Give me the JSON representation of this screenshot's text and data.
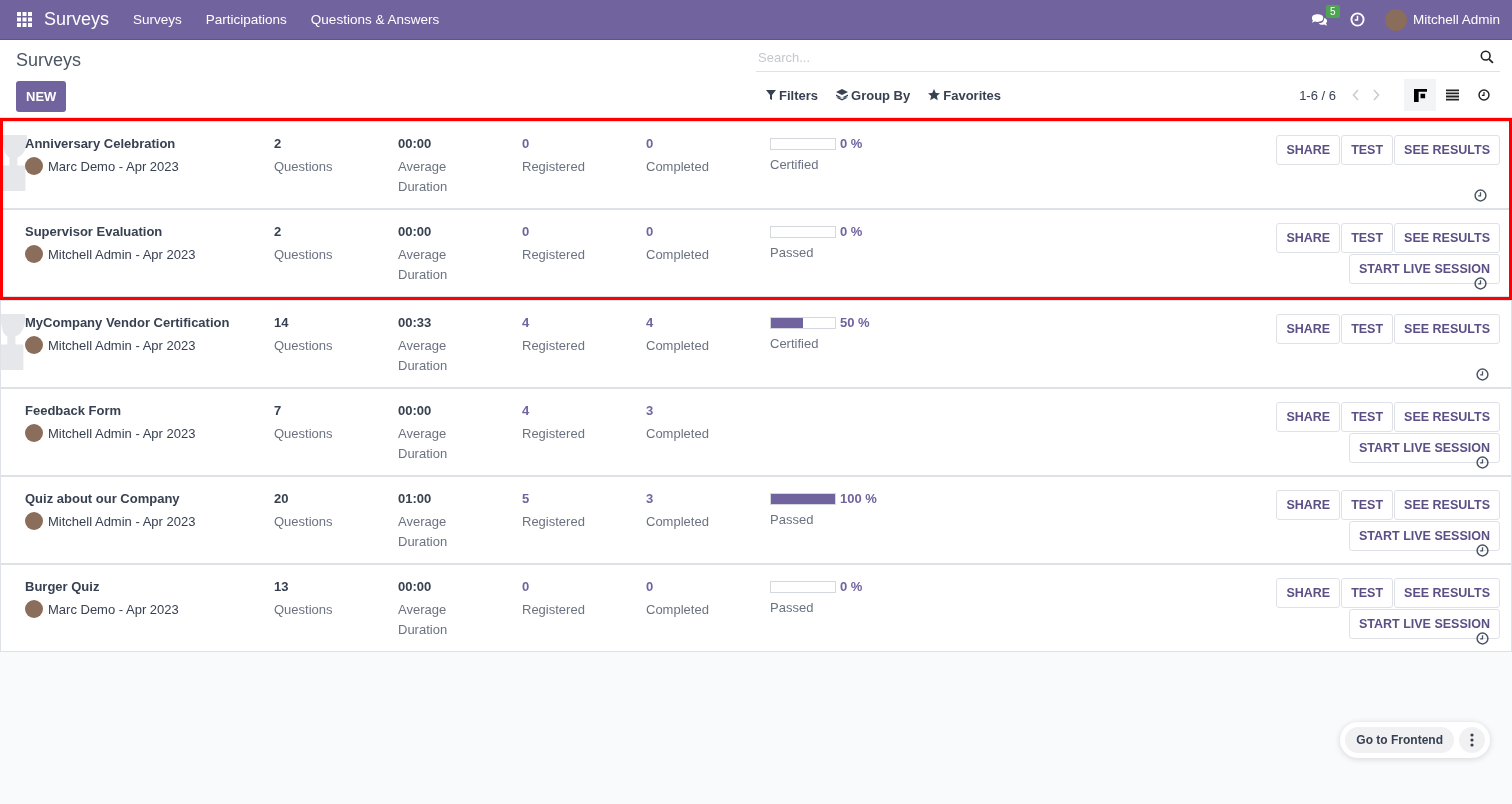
{
  "navbar": {
    "app_name": "Surveys",
    "menu": [
      "Surveys",
      "Participations",
      "Questions & Answers"
    ],
    "messages_count": "5",
    "user_name": "Mitchell Admin"
  },
  "control_panel": {
    "title": "Surveys",
    "new_button": "NEW",
    "search": {
      "placeholder": "Search..."
    },
    "filters": [
      "Filters",
      "Group By",
      "Favorites"
    ],
    "pager": "1-6 / 6",
    "views": [
      {
        "kind": "kanban",
        "selected": true
      },
      {
        "kind": "list",
        "selected": false
      },
      {
        "kind": "activity",
        "selected": false
      }
    ]
  },
  "surveys": [
    {
      "title": "Anniversary Celebration",
      "author": "Marc Demo - Apr 2023",
      "trophy": true,
      "highlighted": true,
      "questions": "2",
      "questions_label": "Questions",
      "duration": "00:00",
      "duration_label": [
        "Average",
        "Duration"
      ],
      "registered": "0",
      "registered_label": "Registered",
      "completed": "0",
      "completed_label": "Completed",
      "progress": {
        "level": 0,
        "percent": "0 %",
        "label": "Certified"
      },
      "buttons": [
        "SHARE",
        "TEST",
        "SEE RESULTS"
      ]
    },
    {
      "title": "Supervisor Evaluation",
      "author": "Mitchell Admin - Apr 2023",
      "trophy": false,
      "highlighted": true,
      "questions": "2",
      "questions_label": "Questions",
      "duration": "00:00",
      "duration_label": [
        "Average",
        "Duration"
      ],
      "registered": "0",
      "registered_label": "Registered",
      "completed": "0",
      "completed_label": "Completed",
      "progress": {
        "level": 0,
        "percent": "0 %",
        "label": "Passed"
      },
      "buttons": [
        "SHARE",
        "TEST",
        "SEE RESULTS"
      ],
      "live_button": "START LIVE SESSION"
    },
    {
      "title": "MyCompany Vendor Certification",
      "author": "Mitchell Admin - Apr 2023",
      "trophy": true,
      "highlighted": false,
      "questions": "14",
      "questions_label": "Questions",
      "duration": "00:33",
      "duration_label": [
        "Average",
        "Duration"
      ],
      "registered": "4",
      "registered_label": "Registered",
      "completed": "4",
      "completed_label": "Completed",
      "progress": {
        "level": 0.5,
        "percent": "50 %",
        "label": "Certified"
      },
      "buttons": [
        "SHARE",
        "TEST",
        "SEE RESULTS"
      ]
    },
    {
      "title": "Feedback Form",
      "author": "Mitchell Admin - Apr 2023",
      "trophy": false,
      "highlighted": false,
      "questions": "7",
      "questions_label": "Questions",
      "duration": "00:00",
      "duration_label": [
        "Average",
        "Duration"
      ],
      "registered": "4",
      "registered_label": "Registered",
      "completed": "3",
      "completed_label": "Completed",
      "buttons": [
        "SHARE",
        "TEST",
        "SEE RESULTS"
      ],
      "live_button": "START LIVE SESSION"
    },
    {
      "title": "Quiz about our Company",
      "author": "Mitchell Admin - Apr 2023",
      "trophy": false,
      "highlighted": false,
      "questions": "20",
      "questions_label": "Questions",
      "duration": "01:00",
      "duration_label": [
        "Average",
        "Duration"
      ],
      "registered": "5",
      "registered_label": "Registered",
      "completed": "3",
      "completed_label": "Completed",
      "progress": {
        "level": 1,
        "percent": "100 %",
        "label": "Passed"
      },
      "buttons": [
        "SHARE",
        "TEST",
        "SEE RESULTS"
      ],
      "live_button": "START LIVE SESSION"
    },
    {
      "title": "Burger Quiz",
      "author": "Marc Demo - Apr 2023",
      "trophy": false,
      "highlighted": false,
      "questions": "13",
      "questions_label": "Questions",
      "duration": "00:00",
      "duration_label": [
        "Average",
        "Duration"
      ],
      "registered": "0",
      "registered_label": "Registered",
      "completed": "0",
      "completed_label": "Completed",
      "progress": {
        "level": 0,
        "percent": "0 %",
        "label": "Passed"
      },
      "buttons": [
        "SHARE",
        "TEST",
        "SEE RESULTS"
      ],
      "live_button": "START LIVE SESSION"
    }
  ],
  "frontend_button": "Go to Frontend"
}
